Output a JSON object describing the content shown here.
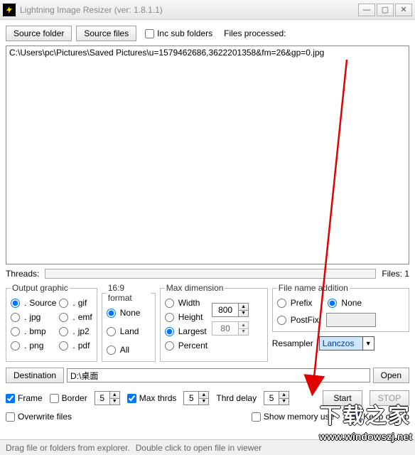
{
  "title": "Lightning Image Resizer (ver: 1.8.1.1)",
  "toprow": {
    "source_folder": "Source folder",
    "source_files": "Source files",
    "inc_sub": "Inc sub folders",
    "files_processed_label": "Files processed:"
  },
  "filelist": {
    "items": [
      "C:\\Users\\pc\\Pictures\\Saved Pictures\\u=1579462686,3622201358&fm=26&gp=0.jpg"
    ]
  },
  "threads": {
    "label": "Threads:",
    "files_label": "Files: 1"
  },
  "output_graphic": {
    "legend": "Output graphic",
    "opts": [
      "Source",
      "jpg",
      "bmp",
      "png",
      "gif",
      "emf",
      "jp2",
      "pdf"
    ],
    "selected": "Source"
  },
  "format169": {
    "legend": "16:9 format",
    "opts": [
      "None",
      "Land",
      "All"
    ],
    "selected": "None"
  },
  "maxdim": {
    "legend": "Max dimension",
    "opts": [
      "Width",
      "Height",
      "Largest",
      "Percent"
    ],
    "selected": "Largest",
    "val1": "800",
    "val2": "80"
  },
  "filename": {
    "legend": "File name addition",
    "opts": [
      "Prefix",
      "PostFix",
      "None"
    ],
    "selected": "None",
    "postfix_value": ""
  },
  "resampler": {
    "label": "Resampler",
    "value": "Lanczos"
  },
  "destination": {
    "btn": "Destination",
    "path": "D:\\桌面",
    "open": "Open"
  },
  "opts": {
    "frame": "Frame",
    "border": "Border",
    "border_val": "5",
    "max_thrds": "Max thrds",
    "max_thrds_val": "5",
    "thrd_delay": "Thrd delay",
    "thrd_delay_val": "5",
    "start": "Start",
    "stop": "STOP",
    "overwrite": "Overwrite files",
    "show_mem": "Show memory use",
    "keep_on_top": "Keep on top"
  },
  "status": {
    "drag": "Drag file or folders from explorer.",
    "dbl": "Double click to open file in viewer"
  },
  "watermark1": "下载之家",
  "watermark2": "www.windowszj.net"
}
